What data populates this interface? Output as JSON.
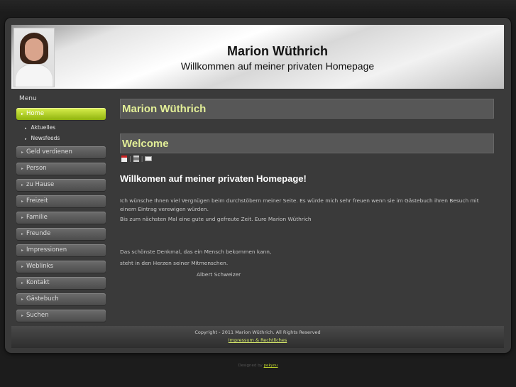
{
  "header": {
    "title": "Marion Wüthrich",
    "subtitle": "Willkommen auf meiner privaten Homepage"
  },
  "sidebar": {
    "heading": "Menu",
    "items": [
      {
        "label": "Home",
        "active": true
      },
      {
        "label": "Geld verdienen"
      },
      {
        "label": "Person"
      },
      {
        "label": "zu Hause"
      },
      {
        "label": "Freizeit"
      },
      {
        "label": "Familie"
      },
      {
        "label": "Freunde"
      },
      {
        "label": "Impressionen"
      },
      {
        "label": "Weblinks"
      },
      {
        "label": "Kontakt"
      },
      {
        "label": "Gästebuch"
      },
      {
        "label": "Suchen"
      }
    ],
    "subitems": [
      "Aktuelles",
      "Newsfeeds"
    ]
  },
  "main": {
    "page_title": "Marion Wüthrich",
    "article_title": "Welcome",
    "heading": "Willkomen auf meiner privaten Homepage!",
    "paragraph1": "Ich wünsche Ihnen viel Vergnügen beim durchstöbern meiner Seite. Es würde mich sehr freuen wenn sie im Gästebuch ihren Besuch mit einem Eintrag verewigen würden.",
    "paragraph2": "Bis zum nächsten Mal eine gute und gefreute Zeit. Eure Marion Wüthrich",
    "quote_line1": "Das schönste Denkmal, das ein Mensch bekommen kann,",
    "quote_line2": "steht in den Herzen seiner Mitmenschen.",
    "quote_author": "Albert Schweizer",
    "icon_separator": "|",
    "icons": [
      "pdf-icon",
      "print-icon",
      "email-icon"
    ]
  },
  "footer": {
    "copyright": "Copyright - 2011 Marion Wüthrich. All Rights Reserved",
    "imprint_link": "Impressum & Rechtliches",
    "designed_by": "Designed by",
    "designer_link": "pekyou"
  },
  "colors": {
    "accent": "#c6e034",
    "heading_accent": "#e2ee97",
    "background": "#1c1c1c",
    "panel": "#3a3a3a"
  }
}
